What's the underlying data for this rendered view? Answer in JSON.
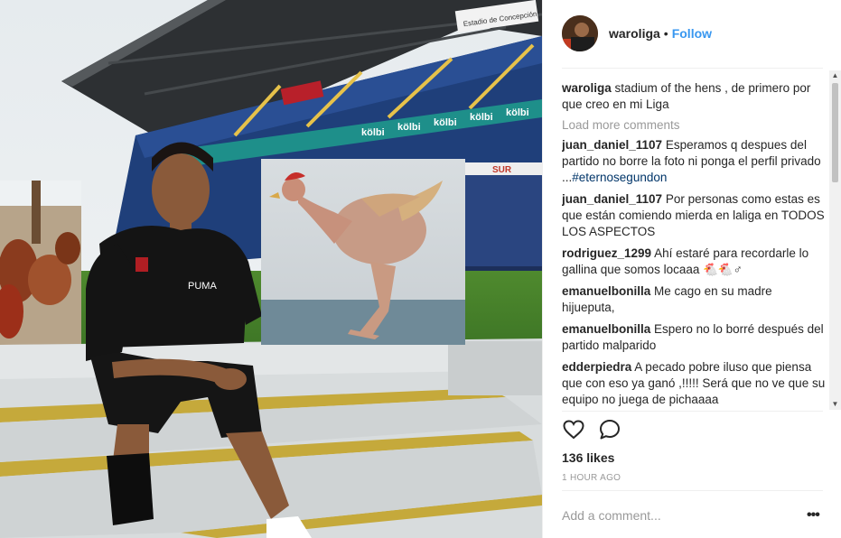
{
  "post": {
    "username": "waroliga",
    "follow_label": "Follow",
    "separator": "•"
  },
  "caption": {
    "username": "waroliga",
    "text": "stadium of the hens , de primero por que creo en mi Liga"
  },
  "load_more": "Load more comments",
  "comments": [
    {
      "username": "juan_daniel_1107",
      "text": "Esperamos q despues del partido no borre la foto ni ponga el perfil privado ...",
      "hashtag": "#eternosegundon"
    },
    {
      "username": "juan_daniel_1107",
      "text": "Por personas como estas es que están comiendo mierda en laliga en TODOS LOS ASPECTOS"
    },
    {
      "username": "rodriguez_1299",
      "text": "Ahí estaré para recordarle lo gallina que somos locaaa 🐔🐔♂"
    },
    {
      "username": "emanuelbonilla",
      "text": "Me cago en su madre hijueputa,"
    },
    {
      "username": "emanuelbonilla",
      "text": "Espero no lo borré después del partido malparido"
    },
    {
      "username": "edderpiedra",
      "text": "A pecado pobre iluso que piensa que con eso ya ganó ,!!!!! Será que no ve que su equipo no juega de pichaaaa"
    }
  ],
  "likes": "136 likes",
  "timestamp": "1 HOUR AGO",
  "add_comment_placeholder": "Add a comment...",
  "more_label": "•••",
  "photo": {
    "signs": [
      "kölbi",
      "kölbi",
      "kölbi",
      "kölbi",
      "kölbi"
    ],
    "sur_label": "SUR",
    "stand_banner": "Estadio de Concepción",
    "colors": {
      "accent": "#3897f0",
      "stand_blue": "#1f3f7a",
      "stand_teal": "#1e8f8a"
    }
  },
  "icons": {
    "like": "heart-icon",
    "comment": "comment-icon",
    "more": "more-icon"
  }
}
